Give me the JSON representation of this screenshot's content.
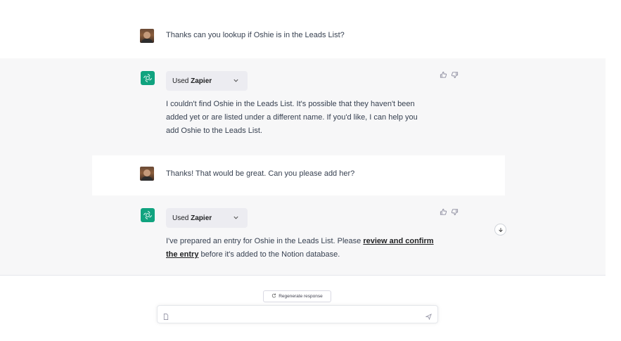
{
  "conversation": {
    "messages": [
      {
        "role": "user",
        "avatar": "user-avatar",
        "text": "Thanks can you lookup if Oshie is in the Leads List?"
      },
      {
        "role": "assistant",
        "avatar": "openai-logo-icon",
        "plugin": {
          "prefix": "Used",
          "name": "Zapier"
        },
        "lines": [
          "I couldn't find Oshie in the Leads List. It's possible that they haven't been",
          "added yet or are listed under a different name. If you'd like, I can help you",
          "add Oshie to the Leads List."
        ]
      },
      {
        "role": "user",
        "avatar": "user-avatar",
        "text": "Thanks! That would be great. Can you please add her?"
      },
      {
        "role": "assistant",
        "avatar": "openai-logo-icon",
        "plugin": {
          "prefix": "Used",
          "name": "Zapier"
        },
        "line1_text": "I've prepared an entry for Oshie in the Leads List. Please ",
        "link_part1": "review and confirm ",
        "link_part2": "the entry",
        "line2_tail": " before it's added to the Notion database."
      }
    ]
  },
  "controls": {
    "regenerate_label": "Regenerate response",
    "input_placeholder": "",
    "icons": [
      "thumbs-up-icon",
      "thumbs-down-icon",
      "chevron-down-icon",
      "arrow-down-icon",
      "refresh-icon",
      "document-icon",
      "send-icon"
    ]
  },
  "colors": {
    "assistant_bg": "#f7f7f8",
    "user_bg": "#ffffff",
    "openai_green": "#10a37f",
    "pill_bg": "#ececf1",
    "text": "#374151"
  }
}
